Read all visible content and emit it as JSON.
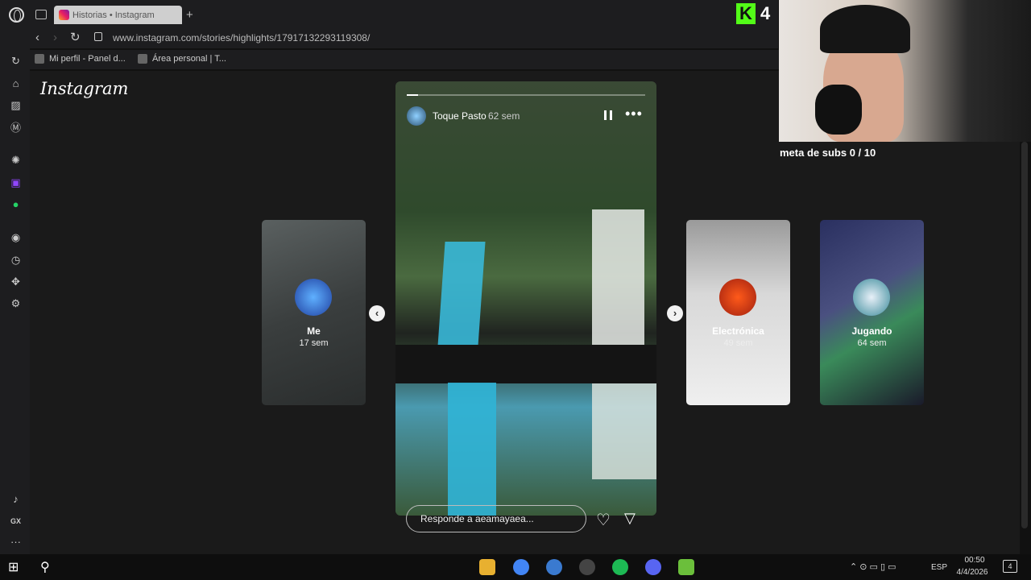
{
  "browser": {
    "tab_title": "Historias • Instagram",
    "new_tab": "+",
    "url": "www.instagram.com/stories/highlights/17917132293119308/",
    "bookmarks": [
      "Mi perfil - Panel d...",
      "Área personal | T..."
    ],
    "nav": {
      "back": "‹",
      "forward": "›",
      "reload": "↻"
    }
  },
  "sidebar": {
    "icons": [
      "speed-dial-icon",
      "flow-icon",
      "pinboard-icon",
      "m-icon",
      "chatgpt-icon",
      "twitch-icon",
      "whatsapp-icon",
      "spotify-icon",
      "history-icon",
      "extensions-icon",
      "settings-icon",
      "player-icon",
      "gx-icon",
      "more-icon"
    ],
    "gx_label": "GX",
    "more_label": "···"
  },
  "instagram": {
    "logo": "Instagram",
    "story": {
      "user": "Toque Pasto",
      "time": "62 sem",
      "reply_placeholder": "Responde a aeamayaea...",
      "pause": "",
      "more": "•••",
      "heart": "♡",
      "share": "▽"
    },
    "side_stories": [
      {
        "name": "Me",
        "time": "17 sem"
      },
      {
        "name": "Electrónica",
        "time": "49 sem"
      },
      {
        "name": "Jugando",
        "time": "64 sem"
      }
    ],
    "prev_arrow": "‹",
    "next_arrow": "›"
  },
  "overlay": {
    "kick_logo": "K",
    "kick_count": "4",
    "meta": "meta de subs 0 / 10"
  },
  "taskbar": {
    "tray_icons": "⌃  ⊙  ▭  ▯  ▭",
    "lang": "ESP",
    "time": "00:50",
    "date": "4/4/2026",
    "notif": "4"
  }
}
